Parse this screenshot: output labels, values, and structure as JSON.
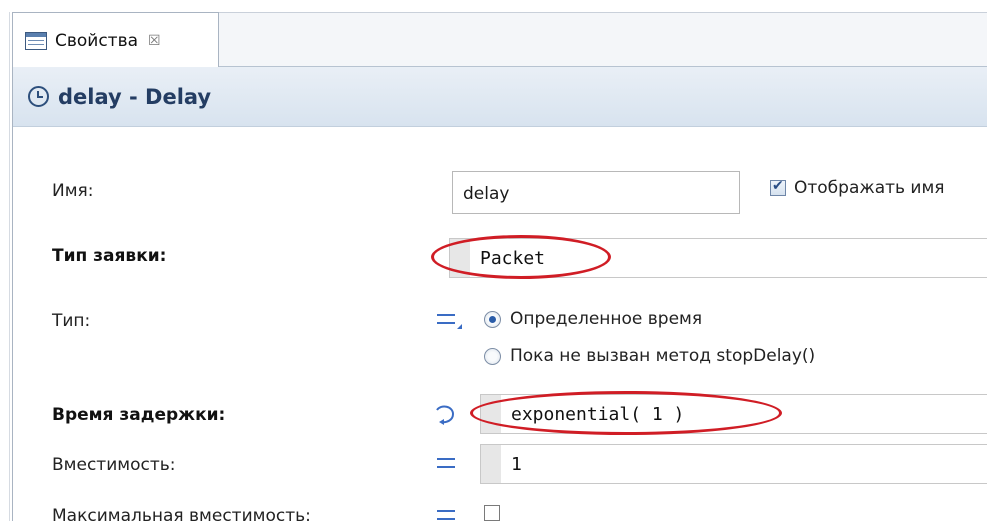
{
  "tab": {
    "label": "Свойства",
    "close_glyph": "☒",
    "icon": "properties-table-icon"
  },
  "header": {
    "title": "delay - Delay",
    "icon": "clock-icon"
  },
  "fields": {
    "name": {
      "label": "Имя:",
      "value": "delay"
    },
    "show_name": {
      "label": "Отображать имя",
      "checked": true
    },
    "agent_type": {
      "label": "Тип заявки:",
      "value": "Packet"
    },
    "type": {
      "label": "Тип:",
      "options": [
        {
          "label": "Определенное время",
          "selected": true
        },
        {
          "label": "Пока не вызван метод stopDelay()",
          "selected": false
        }
      ]
    },
    "delay_time": {
      "label": "Время задержки:",
      "value": "exponential( 1 )"
    },
    "capacity": {
      "label": "Вместимость:",
      "value": "1"
    },
    "max_capacity": {
      "label": "Максимальная вместимость:",
      "checked": false
    }
  },
  "colors": {
    "accent": "#243d63",
    "highlight_ellipse": "#d01d25",
    "icon_blue": "#3a6cc4"
  }
}
